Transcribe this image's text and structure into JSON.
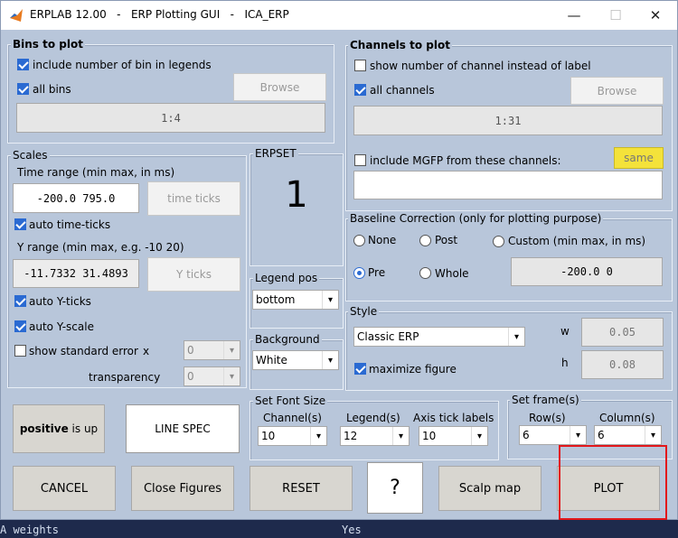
{
  "window": {
    "title": "ERPLAB 12.00   -   ERP Plotting GUI   -   ICA_ERP",
    "minimize": "—",
    "maximize": "☐",
    "close": "✕"
  },
  "bins": {
    "title": "Bins to plot",
    "include_number_label": "include number of bin in legends",
    "include_number_checked": true,
    "all_bins_label": "all bins",
    "all_bins_checked": true,
    "browse": "Browse",
    "range": "1:4"
  },
  "channels": {
    "title": "Channels to plot",
    "show_number_label": "show number of channel instead of label",
    "show_number_checked": false,
    "all_channels_label": "all channels",
    "all_channels_checked": true,
    "browse": "Browse",
    "range": "1:31",
    "mgfp_label": "include MGFP from these channels:",
    "mgfp_checked": false,
    "same": "same",
    "mgfp_value": ""
  },
  "scales": {
    "title": "Scales",
    "time_range_label": "Time range (min max, in ms)",
    "time_range_value": "-200.0 795.0",
    "time_ticks": "time ticks",
    "auto_time_ticks": "auto time-ticks",
    "y_range_label": "Y range (min max, e.g. -10   20)",
    "y_range_value": "-11.7332 31.4893",
    "y_ticks": "Y ticks",
    "auto_y_ticks": "auto Y-ticks",
    "auto_y_scale": "auto Y-scale",
    "show_std_error": "show standard error",
    "x_label": "x",
    "x_value": "0",
    "transparency_label": "transparency",
    "transparency_value": "0"
  },
  "polarity": {
    "bold": "positive",
    "rest": " is up"
  },
  "line_spec": "LINE SPEC",
  "erpset": {
    "title": "ERPSET",
    "value": "1"
  },
  "legend_pos": {
    "title": "Legend pos",
    "value": "bottom"
  },
  "background": {
    "title": "Background",
    "value": "White"
  },
  "baseline": {
    "title": "Baseline Correction (only for plotting purpose)",
    "none": "None",
    "post": "Post",
    "custom": "Custom (min max, in ms)",
    "pre": "Pre",
    "whole": "Whole",
    "selected": "pre",
    "value": "-200.0   0"
  },
  "style": {
    "title": "Style",
    "value": "Classic ERP",
    "maximize_label": "maximize figure",
    "maximize_checked": true,
    "w_label": "w",
    "w_value": "0.05",
    "h_label": "h",
    "h_value": "0.08"
  },
  "font_size": {
    "title": "Set Font Size",
    "channel_label": "Channel(s)",
    "channel_value": "10",
    "legend_label": "Legend(s)",
    "legend_value": "12",
    "axis_label": "Axis tick labels",
    "axis_value": "10"
  },
  "frames": {
    "title": "Set frame(s)",
    "row_label": "Row(s)",
    "row_value": "6",
    "col_label": "Column(s)",
    "col_value": "6"
  },
  "buttons": {
    "cancel": "CANCEL",
    "close_figures": "Close Figures",
    "reset": "RESET",
    "help": "?",
    "scalp_map": "Scalp map",
    "plot": "PLOT"
  },
  "below_window": {
    "left": "A weights",
    "right": "Yes"
  },
  "colors": {
    "window_bg": "#b8c6da",
    "checkbox_blue": "#2a6ad2",
    "same_button": "#f4e23a",
    "highlight": "#e2171b"
  }
}
